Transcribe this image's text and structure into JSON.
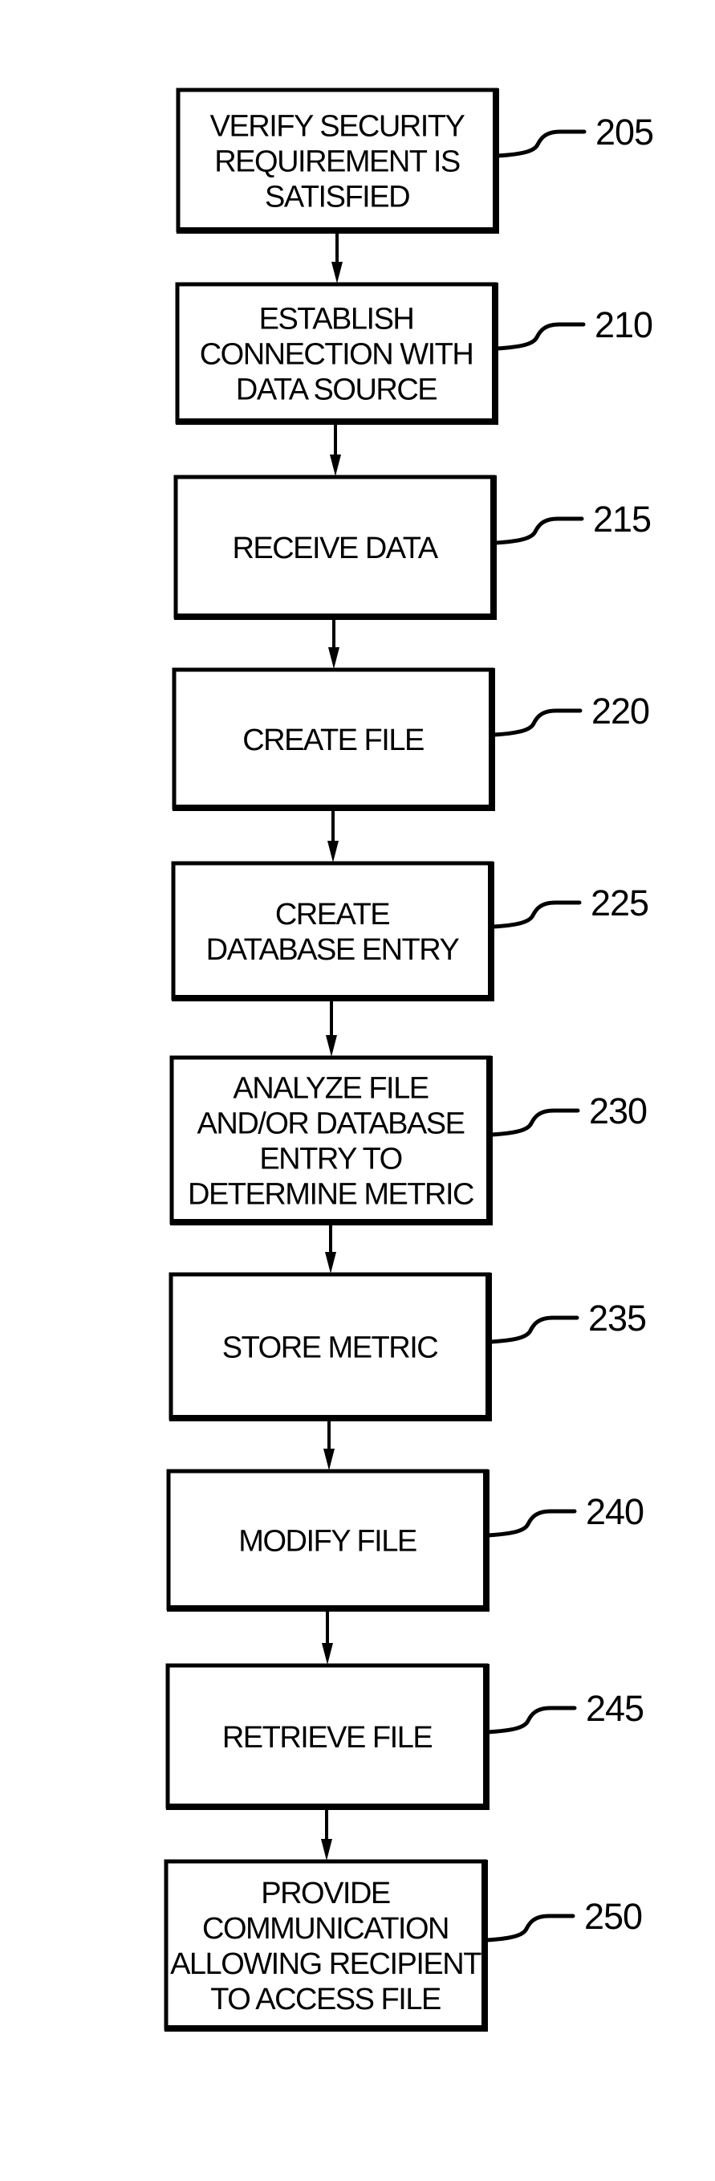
{
  "diagram": {
    "type": "flowchart",
    "direction": "top-to-bottom",
    "colors": {
      "line": "#000000",
      "background": "#ffffff"
    },
    "steps": [
      {
        "ref": "205",
        "lines": [
          "VERIFY SECURITY",
          "REQUIREMENT IS",
          "SATISFIED"
        ]
      },
      {
        "ref": "210",
        "lines": [
          "ESTABLISH",
          "CONNECTION WITH",
          "DATA SOURCE"
        ]
      },
      {
        "ref": "215",
        "lines": [
          "RECEIVE DATA"
        ]
      },
      {
        "ref": "220",
        "lines": [
          "CREATE FILE"
        ]
      },
      {
        "ref": "225",
        "lines": [
          "CREATE",
          "DATABASE ENTRY"
        ]
      },
      {
        "ref": "230",
        "lines": [
          "ANALYZE FILE",
          "AND/OR DATABASE",
          "ENTRY TO",
          "DETERMINE METRIC"
        ]
      },
      {
        "ref": "235",
        "lines": [
          "STORE METRIC"
        ]
      },
      {
        "ref": "240",
        "lines": [
          "MODIFY FILE"
        ]
      },
      {
        "ref": "245",
        "lines": [
          "RETRIEVE FILE"
        ]
      },
      {
        "ref": "250",
        "lines": [
          "PROVIDE",
          "COMMUNICATION",
          "ALLOWING RECIPIENT",
          "TO ACCESS FILE"
        ]
      }
    ],
    "edges": [
      {
        "from": "205",
        "to": "210"
      },
      {
        "from": "210",
        "to": "215"
      },
      {
        "from": "215",
        "to": "220"
      },
      {
        "from": "220",
        "to": "225"
      },
      {
        "from": "225",
        "to": "230"
      },
      {
        "from": "230",
        "to": "235"
      },
      {
        "from": "235",
        "to": "240"
      },
      {
        "from": "240",
        "to": "245"
      },
      {
        "from": "245",
        "to": "250"
      }
    ]
  }
}
